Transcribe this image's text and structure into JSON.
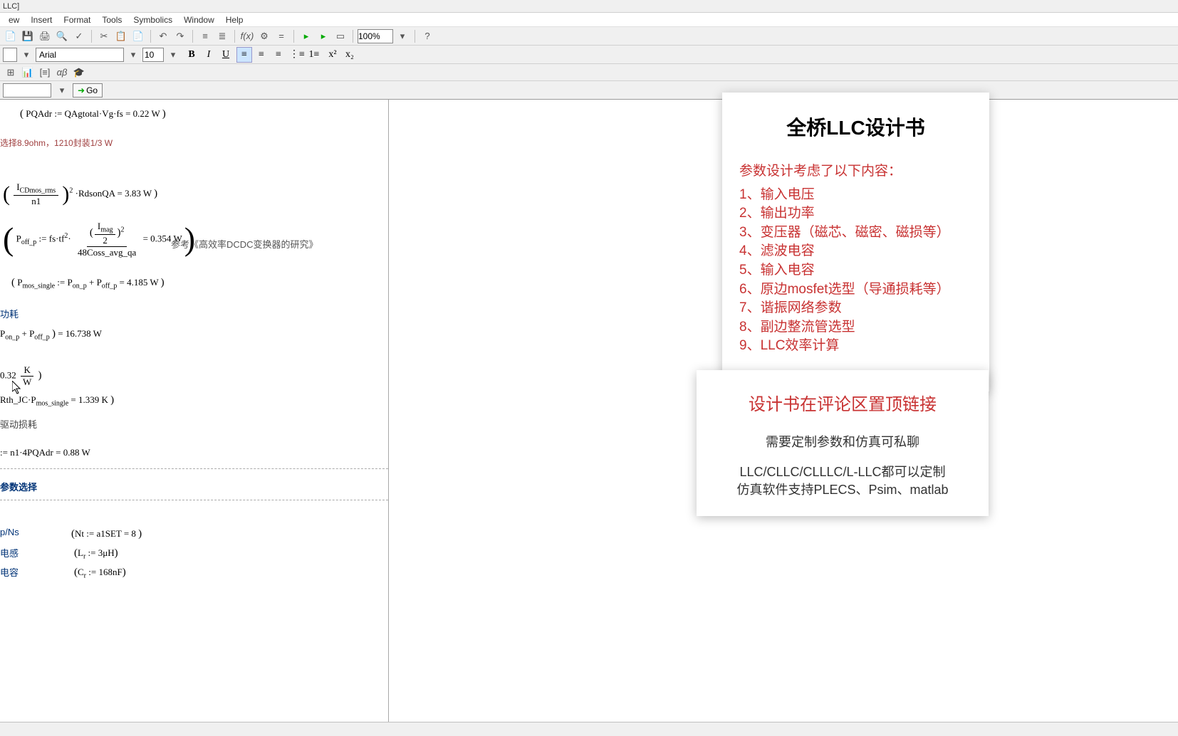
{
  "window": {
    "title": "LLC]"
  },
  "menubar": [
    "ew",
    "Insert",
    "Format",
    "Tools",
    "Symbolics",
    "Window",
    "Help"
  ],
  "toolbar": {
    "zoom": "100%",
    "go_label": "Go"
  },
  "format_bar": {
    "font": "Arial",
    "size": "10"
  },
  "document": {
    "eq1": "PQAdr := QAgtotal·Vg·fs = 0.22 W",
    "note1": "选择8.9ohm，1210封装1/3 W",
    "eq2_lhs_num": "I_CDmos_rms",
    "eq2_lhs_den": "n1",
    "eq2_rhs": "·RdsonQA = 3.83 W",
    "eq3_lhs": "P_off_p := fs·tf",
    "eq3_mid_num": "I_mag",
    "eq3_mid_den": "2",
    "eq3_frac_den": "48Coss_avg_qa",
    "eq3_val": " = 0.354 W",
    "eq3_note": "参考《高效率DCDC变换器的研究》",
    "eq4": "P_mos_single := P_on_p + P_off_p = 4.185 W",
    "section_label_1": "功耗",
    "eq5": "P_on_p + P_off_p ) = 16.738 W",
    "eq6": "0.32 K/W",
    "eq7": "Rth_JC·P_mos_single = 1.339 K",
    "section_label_2": "驱动损耗",
    "eq8": ":= n1·4PQAdr = 0.88 W",
    "section_heading": "参数选择",
    "col_a": "p/Ns",
    "col_b": "电感",
    "col_c": "电容",
    "val_a": "Nt := a1SET = 8",
    "val_b": "L_r := 3μH",
    "val_c": "C_r := 168nF"
  },
  "card1": {
    "title": "全桥LLC设计书",
    "subtitle": "参数设计考虑了以下内容：",
    "items": [
      "1、输入电压",
      "2、输出功率",
      "3、变压器（磁芯、磁密、磁损等）",
      "4、滤波电容",
      "5、输入电容",
      "6、原边mosfet选型（导通损耗等）",
      "7、谐振网络参数",
      "8、副边整流管选型",
      "9、LLC效率计算"
    ]
  },
  "card2": {
    "t1": "设计书在评论区置顶链接",
    "t2": "需要定制参数和仿真可私聊",
    "t3a": "LLC/CLLC/CLLLC/L-LLC都可以定制",
    "t3b": "仿真软件支持PLECS、Psim、matlab"
  }
}
